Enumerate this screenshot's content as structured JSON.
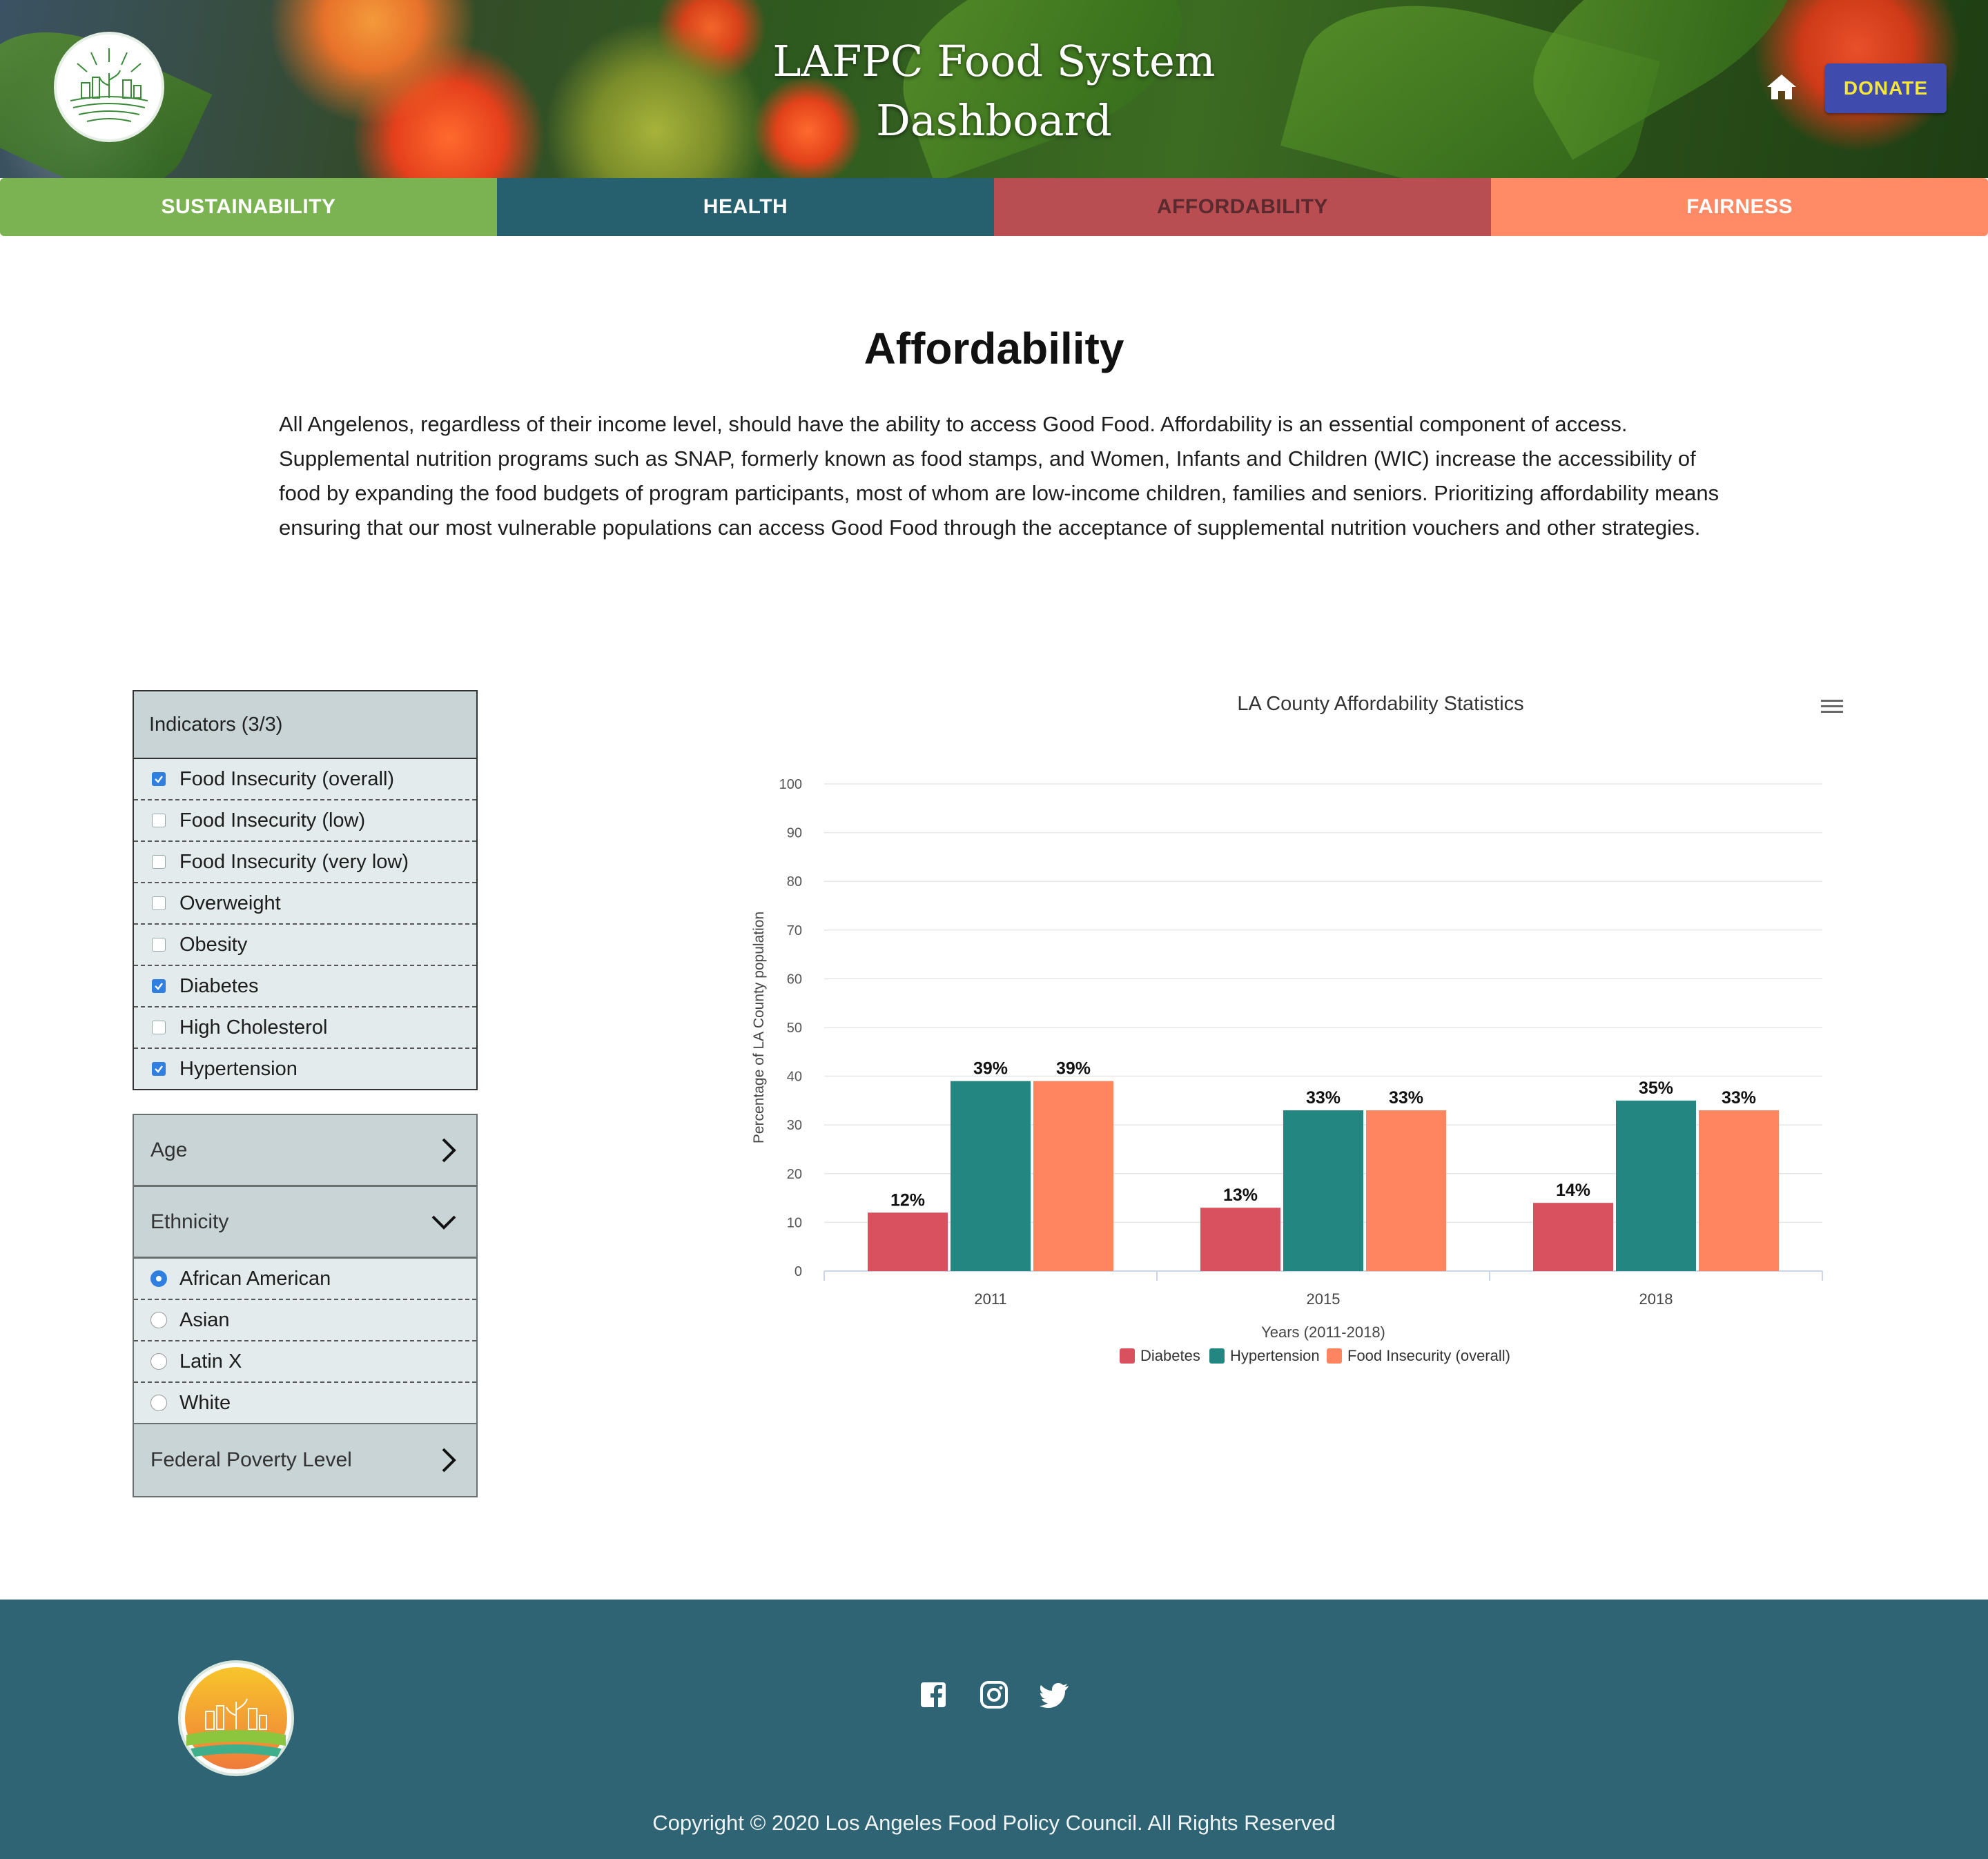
{
  "header": {
    "title_line1": "LAFPC Food System",
    "title_line2": "Dashboard",
    "donate_label": "DONATE"
  },
  "nav": {
    "tabs": [
      "SUSTAINABILITY",
      "HEALTH",
      "AFFORDABILITY",
      "FAIRNESS"
    ],
    "active": "AFFORDABILITY"
  },
  "main": {
    "heading": "Affordability",
    "intro": "All Angelenos, regardless of their income level, should have the ability to access Good Food. Affordability is an essential component of access. Supplemental nutrition programs such as SNAP, formerly known as food stamps, and Women, Infants and Children (WIC) increase the accessibility of food by expanding the food budgets of program participants, most of whom are low-income children, families and seniors. Prioritizing affordability means ensuring that our most vulnerable populations can access Good Food through the acceptance of supplemental nutrition vouchers and other strategies."
  },
  "indicators": {
    "header": "Indicators (3/3)",
    "items": [
      {
        "label": "Food Insecurity (overall)",
        "checked": true
      },
      {
        "label": "Food Insecurity (low)",
        "checked": false
      },
      {
        "label": "Food Insecurity (very low)",
        "checked": false
      },
      {
        "label": "Overweight",
        "checked": false
      },
      {
        "label": "Obesity",
        "checked": false
      },
      {
        "label": "Diabetes",
        "checked": true
      },
      {
        "label": "High Cholesterol",
        "checked": false
      },
      {
        "label": "Hypertension",
        "checked": true
      }
    ]
  },
  "filters": {
    "age_label": "Age",
    "ethnicity_label": "Ethnicity",
    "ethnicity_options": [
      {
        "label": "African American",
        "selected": true
      },
      {
        "label": "Asian",
        "selected": false
      },
      {
        "label": "Latin X",
        "selected": false
      },
      {
        "label": "White",
        "selected": false
      }
    ],
    "fpl_label": "Federal Poverty Level"
  },
  "chart_data": {
    "type": "bar",
    "title": "LA County Affordability Statistics",
    "xlabel": "Years (2011-2018)",
    "ylabel": "Percentage of LA County population",
    "categories": [
      "2011",
      "2015",
      "2018"
    ],
    "ylim": [
      0,
      100
    ],
    "yticks": [
      0,
      10,
      20,
      30,
      40,
      50,
      60,
      70,
      80,
      90,
      100
    ],
    "grid": true,
    "legend": "bottom-center",
    "series": [
      {
        "name": "Diabetes",
        "values": [
          12,
          13,
          14
        ],
        "labels": [
          "12%",
          "13%",
          "14%"
        ],
        "color": "#d9515e"
      },
      {
        "name": "Hypertension",
        "values": [
          39,
          33,
          35
        ],
        "labels": [
          "39%",
          "33%",
          "35%"
        ],
        "color": "#248681"
      },
      {
        "name": "Food Insecurity (overall)",
        "values": [
          39,
          33,
          33
        ],
        "labels": [
          "39%",
          "33%",
          "33%"
        ],
        "color": "#ff8560"
      }
    ]
  },
  "footer": {
    "social": [
      "facebook-icon",
      "instagram-icon",
      "twitter-icon"
    ],
    "copyright": "Copyright © 2020 Los Angeles Food Policy Council. All Rights Reserved"
  },
  "colors": {
    "sustainability": "#7cb352",
    "health": "#265f6d",
    "affordability": "#b84d52",
    "fairness": "#ff8a65",
    "donate_bg": "#3f4cae",
    "donate_text": "#f5e63a",
    "footer_bg": "#2e6473"
  }
}
